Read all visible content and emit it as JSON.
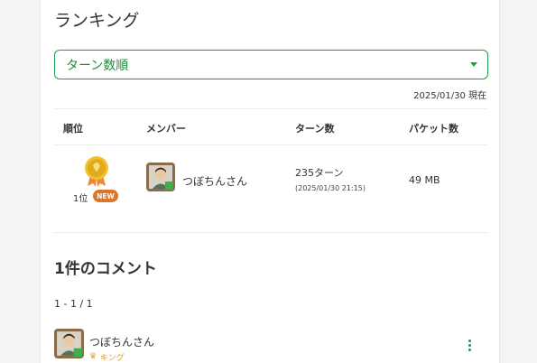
{
  "ranking": {
    "title": "ランキング",
    "sort_select": {
      "value": "ターン数順"
    },
    "as_of": "2025/01/30 現在",
    "columns": [
      "順位",
      "メンバー",
      "ターン数",
      "パケット数"
    ],
    "rows": [
      {
        "rank_label": "1位",
        "badge": "NEW",
        "member": "つぼちんさん",
        "turns": "235ターン",
        "turns_date": "(2025/01/30 21:15)",
        "packets": "49 MB",
        "medal_color": "#e9b61a"
      }
    ]
  },
  "comments": {
    "title": "1件のコメント",
    "pager": "1 - 1 / 1",
    "items": [
      {
        "name": "つぼちんさん",
        "role": "キング"
      }
    ]
  },
  "colors": {
    "accent": "#1aa14a",
    "badge": "#d9762b",
    "role": "#e6a12b"
  }
}
